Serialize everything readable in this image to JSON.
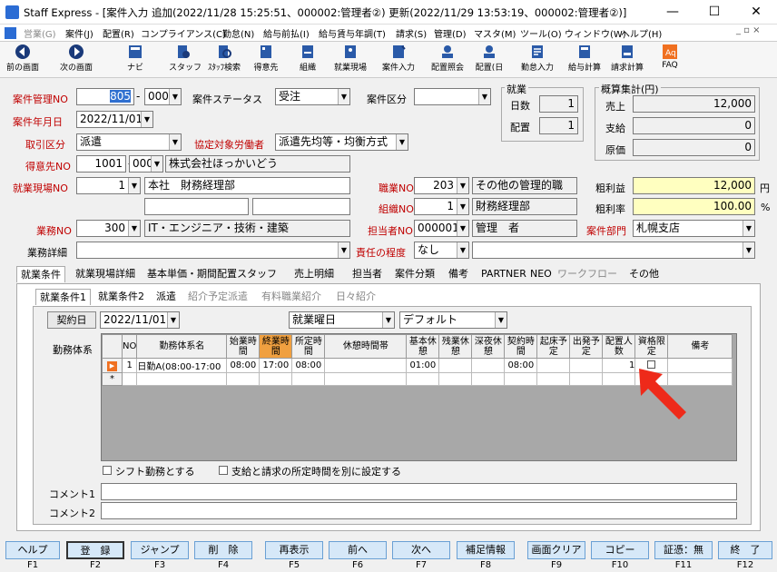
{
  "window": {
    "title": "Staff Express - [案件入力 追加(2022/11/28 15:25:51、000002:管理者②) 更新(2022/11/29 13:53:19、000002:管理者②)]",
    "minimize": "—",
    "maximize": "☐",
    "close": "✕"
  },
  "menu": [
    "営業(G)",
    "案件(J)",
    "配置(R)",
    "コンプライアンス(C)",
    "勤怠(N)",
    "給与前払(I)",
    "給与賃与年調(T)",
    "請求(S)",
    "管理(D)",
    "マスタ(M)",
    "ツール(O)",
    "ウィンドウ(W)",
    "ヘルプ(H)"
  ],
  "toolbar": [
    {
      "label": "前の画面"
    },
    {
      "label": "次の画面"
    },
    {
      "label": "ナビ"
    },
    {
      "label": "スタッフ"
    },
    {
      "label": "ｽﾀｯﾌ検索"
    },
    {
      "label": "得意先"
    },
    {
      "label": "組織"
    },
    {
      "label": "就業現場"
    },
    {
      "label": "案件入力"
    },
    {
      "label": "配置照会"
    },
    {
      "label": "配置(日"
    },
    {
      "label": "勤怠入力"
    },
    {
      "label": "給与計算"
    },
    {
      "label": "請求計算"
    },
    {
      "label": "FAQ"
    }
  ],
  "form": {
    "case_no_label": "案件管理NO",
    "case_no": "805",
    "case_no_sub": "000",
    "case_status_label": "案件ステータス",
    "case_status": "受注",
    "case_kind_label": "案件区分",
    "case_kind": "",
    "date_label": "案件年月日",
    "date": "2022/11/01",
    "trade_label": "取引区分",
    "trade": "派遣",
    "target_label": "協定対象労働者",
    "target": "派遣先均等・均衡方式",
    "customer_label": "得意先NO",
    "customer_no": "1001",
    "customer_sub": "000",
    "customer_name": "株式会社ほっかいどう",
    "site_label": "就業現場NO",
    "site_no": "1",
    "site_name": "本社　財務経理部",
    "job_label": "職業NO",
    "job_no": "203",
    "job_name": "その他の管理的職",
    "org_label": "組織NO",
    "org_no": "1",
    "org_name": "財務経理部",
    "work_label": "業務NO",
    "work_no": "300",
    "work_name": "IT・エンジニア・技術・建築",
    "rep_label": "担当者NO",
    "rep_no": "000001",
    "rep_name": "管理　者",
    "dept_label": "案件部門",
    "dept": "札幌支店",
    "detail_label": "業務詳細",
    "resp_label": "責任の程度",
    "resp": "なし"
  },
  "employment": {
    "title": "就業",
    "days_label": "日数",
    "days": "1",
    "alloc_label": "配置",
    "alloc": "1"
  },
  "summary": {
    "title": "概算集計(円)",
    "sales_label": "売上",
    "sales": "12,000",
    "pay_label": "支給",
    "pay": "0",
    "cost_label": "原価",
    "cost": "0",
    "profit_label": "粗利益",
    "profit": "12,000",
    "profit_unit": "円",
    "rate_label": "粗利率",
    "rate": "100.00",
    "rate_unit": "%"
  },
  "tabs": [
    "就業条件",
    "就業現場詳細",
    "基本単価・期間配置スタッフ",
    "売上明細",
    "担当者",
    "案件分類",
    "備考",
    "PARTNER",
    "NEO",
    "ワークフロー",
    "その他"
  ],
  "subtabs": [
    "就業条件1",
    "就業条件2",
    "派遣",
    "紹介予定派遣",
    "有料職業紹介",
    "日々紹介"
  ],
  "contract": {
    "button": "契約日",
    "date": "2022/11/01",
    "weekday": "就業曜日",
    "pattern": "デフォルト"
  },
  "grid": {
    "label": "勤務体系",
    "headers": [
      "NO",
      "勤務体系名",
      "始業時間",
      "終業時間",
      "所定時間",
      "休憩時間帯",
      "基本休憩",
      "残業休憩",
      "深夜休憩",
      "契約時間",
      "起床予定",
      "出発予定",
      "配置人数",
      "資格限定",
      "備考"
    ],
    "row": {
      "no": "1",
      "name": "日勤A(08:00-17:00",
      "start": "08:00",
      "end": "17:00",
      "fixed": "08:00",
      "break_band": "",
      "basic": "01:00",
      "over": "",
      "night": "",
      "contract": "08:00",
      "wake": "",
      "leave": "",
      "count": "1",
      "qual": "",
      "note": ""
    },
    "new_marker": "*"
  },
  "options": {
    "shift": "シフト勤務とする",
    "separate": "支給と請求の所定時間を別に設定する"
  },
  "comments": {
    "c1": "コメント1",
    "c2": "コメント2"
  },
  "fkeys": [
    {
      "label": "ヘルプ",
      "key": "F1"
    },
    {
      "label": "登　録",
      "key": "F2"
    },
    {
      "label": "ジャンプ",
      "key": "F3"
    },
    {
      "label": "削　除",
      "key": "F4"
    },
    {
      "label": "再表示",
      "key": "F5"
    },
    {
      "label": "前へ",
      "key": "F6"
    },
    {
      "label": "次へ",
      "key": "F7"
    },
    {
      "label": "補足情報",
      "key": "F8"
    },
    {
      "label": "画面クリア",
      "key": "F9"
    },
    {
      "label": "コピー",
      "key": "F10"
    },
    {
      "label": "証憑：無",
      "key": "F11"
    },
    {
      "label": "終　了",
      "key": "F12"
    }
  ]
}
